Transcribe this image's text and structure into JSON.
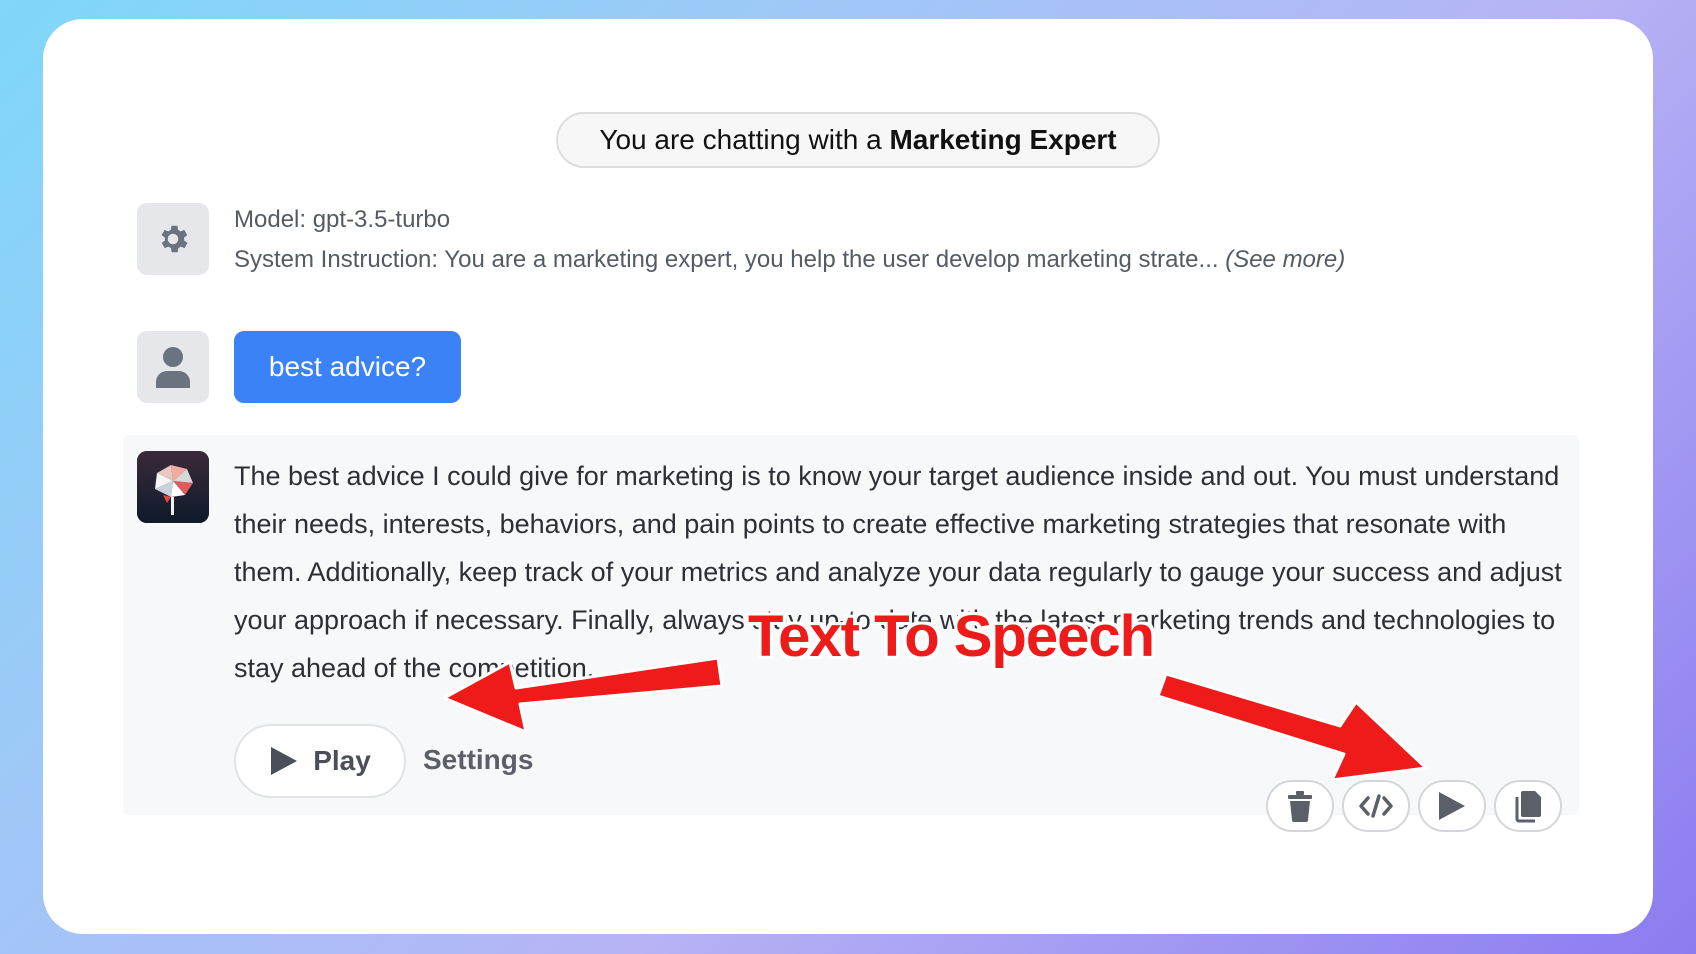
{
  "header": {
    "prefix": "You are chatting with a ",
    "expert": "Marketing Expert"
  },
  "system": {
    "icon": "gear-icon",
    "model": "Model: gpt-3.5-turbo",
    "instruction": "System Instruction: You are a marketing expert, you help the user develop marketing strate...",
    "see_more": "(See more)"
  },
  "user_message": {
    "icon": "user-icon",
    "text": "best advice?"
  },
  "assistant_message": {
    "icon": "brain-logo",
    "text": "The best advice I could give for marketing is to know your target audience inside and out. You must understand their needs, interests, behaviors, and pain points to create effective marketing strategies that resonate with them. Additionally, keep track of your metrics and analyze your data regularly to gauge your success and adjust your approach if necessary. Finally, always stay up-to-date with the latest marketing trends and technologies to stay ahead of the competition."
  },
  "tts": {
    "play_label": "Play",
    "settings_label": "Settings"
  },
  "actions": [
    "trash-icon",
    "code-icon",
    "play-icon",
    "copy-icon"
  ],
  "annotation": {
    "label": "Text To Speech",
    "color": "#ef1b1b"
  }
}
